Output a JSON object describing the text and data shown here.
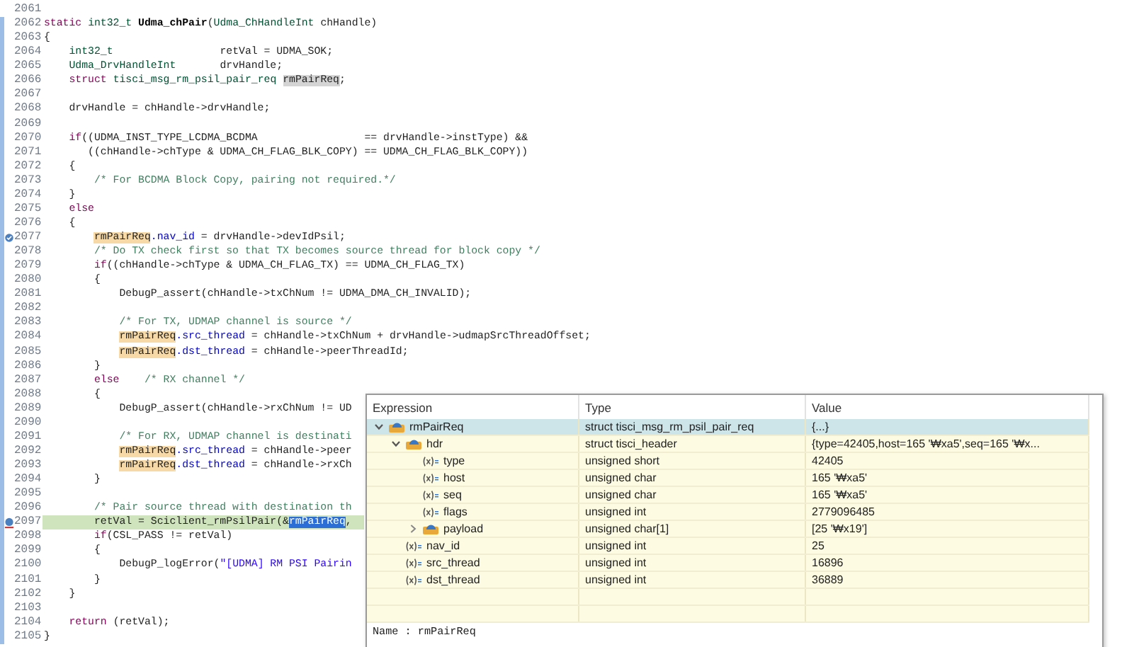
{
  "editor": {
    "lines": [
      {
        "n": "2061"
      },
      {
        "n": "2062",
        "segments": [
          {
            "kind": "keyword",
            "text": "static"
          },
          {
            "kind": "type",
            "text": " int32_t"
          },
          {
            "kind": "func",
            "text": " Udma_chPair"
          },
          {
            "kind": "plain",
            "text": "("
          },
          {
            "kind": "type",
            "text": "Udma_ChHandleInt"
          },
          {
            "kind": "plain",
            "text": " chHandle)"
          }
        ]
      },
      {
        "n": "2063",
        "segments": [
          {
            "kind": "plain",
            "text": "{"
          }
        ]
      },
      {
        "n": "2064",
        "segments": [
          {
            "kind": "type",
            "text": "    int32_t"
          },
          {
            "kind": "plain",
            "text": "                 retVal = UDMA_SOK;"
          }
        ]
      },
      {
        "n": "2065",
        "segments": [
          {
            "kind": "type",
            "text": "    Udma_DrvHandleInt"
          },
          {
            "kind": "plain",
            "text": "       drvHandle;"
          }
        ]
      },
      {
        "n": "2066",
        "segments": [
          {
            "kind": "keyword",
            "text": "    struct"
          },
          {
            "kind": "type",
            "text": " tisci_msg_rm_psil_pair_req"
          },
          {
            "kind": "declaration",
            "text": " rmPairReq"
          },
          {
            "kind": "plain",
            "text": ";"
          }
        ]
      },
      {
        "n": "2067"
      },
      {
        "n": "2068",
        "segments": [
          {
            "kind": "plain",
            "text": "    drvHandle = chHandle->drvHandle;"
          }
        ]
      },
      {
        "n": "2069"
      },
      {
        "n": "2070",
        "segments": [
          {
            "kind": "keyword",
            "text": "    if"
          },
          {
            "kind": "plain",
            "text": "((UDMA_INST_TYPE_LCDMA_BCDMA                 == drvHandle->instType) &&"
          }
        ]
      },
      {
        "n": "2071",
        "segments": [
          {
            "kind": "plain",
            "text": "       ((chHandle->chType & UDMA_CH_FLAG_BLK_COPY) == UDMA_CH_FLAG_BLK_COPY))"
          }
        ]
      },
      {
        "n": "2072",
        "segments": [
          {
            "kind": "plain",
            "text": "    {"
          }
        ]
      },
      {
        "n": "2073",
        "segments": [
          {
            "kind": "comment",
            "text": "        /* For BCDMA Block Copy, pairing not required.*/"
          }
        ]
      },
      {
        "n": "2074",
        "segments": [
          {
            "kind": "plain",
            "text": "    }"
          }
        ]
      },
      {
        "n": "2075",
        "segments": [
          {
            "kind": "keyword",
            "text": "    else"
          }
        ]
      },
      {
        "n": "2076",
        "segments": [
          {
            "kind": "plain",
            "text": "    {"
          }
        ]
      },
      {
        "n": "2077",
        "kind": "breakpoint",
        "segments": [
          {
            "kind": "occurrence",
            "text": "        rmPairReq"
          },
          {
            "kind": "field",
            "text": ".nav_id"
          },
          {
            "kind": "plain",
            "text": " = drvHandle->devIdPsil;"
          }
        ]
      },
      {
        "n": "2078",
        "segments": [
          {
            "kind": "comment",
            "text": "        /* Do TX check first so that TX becomes source thread for block copy */"
          }
        ]
      },
      {
        "n": "2079",
        "segments": [
          {
            "kind": "keyword",
            "text": "        if"
          },
          {
            "kind": "plain",
            "text": "((chHandle->chType & UDMA_CH_FLAG_TX) == UDMA_CH_FLAG_TX)"
          }
        ]
      },
      {
        "n": "2080",
        "segments": [
          {
            "kind": "plain",
            "text": "        {"
          }
        ]
      },
      {
        "n": "2081",
        "segments": [
          {
            "kind": "plain",
            "text": "            DebugP_assert(chHandle->txChNum != UDMA_DMA_CH_INVALID);"
          }
        ]
      },
      {
        "n": "2082"
      },
      {
        "n": "2083",
        "segments": [
          {
            "kind": "comment",
            "text": "            /* For TX, UDMAP channel is source */"
          }
        ]
      },
      {
        "n": "2084",
        "segments": [
          {
            "kind": "occurrence",
            "text": "            rmPairReq"
          },
          {
            "kind": "field",
            "text": ".src_thread"
          },
          {
            "kind": "plain",
            "text": " = chHandle->txChNum + drvHandle->udmapSrcThreadOffset;"
          }
        ]
      },
      {
        "n": "2085",
        "segments": [
          {
            "kind": "occurrence",
            "text": "            rmPairReq"
          },
          {
            "kind": "field",
            "text": ".dst_thread"
          },
          {
            "kind": "plain",
            "text": " = chHandle->peerThreadId;"
          }
        ]
      },
      {
        "n": "2086",
        "segments": [
          {
            "kind": "plain",
            "text": "        }"
          }
        ]
      },
      {
        "n": "2087",
        "segments": [
          {
            "kind": "keyword",
            "text": "        else"
          },
          {
            "kind": "comment",
            "text": "    /* RX channel */"
          }
        ]
      },
      {
        "n": "2088",
        "segments": [
          {
            "kind": "plain",
            "text": "        {"
          }
        ]
      },
      {
        "n": "2089",
        "segments": [
          {
            "kind": "plain",
            "text": "            DebugP_assert(chHandle->rxChNum != UD"
          }
        ]
      },
      {
        "n": "2090"
      },
      {
        "n": "2091",
        "segments": [
          {
            "kind": "comment",
            "text": "            /* For RX, UDMAP channel is destinati"
          }
        ]
      },
      {
        "n": "2092",
        "segments": [
          {
            "kind": "occurrence",
            "text": "            rmPairReq"
          },
          {
            "kind": "field",
            "text": ".src_thread"
          },
          {
            "kind": "plain",
            "text": " = chHandle->peer"
          }
        ]
      },
      {
        "n": "2093",
        "segments": [
          {
            "kind": "occurrence",
            "text": "            rmPairReq"
          },
          {
            "kind": "field",
            "text": ".dst_thread"
          },
          {
            "kind": "plain",
            "text": " = chHandle->rxCh"
          }
        ]
      },
      {
        "n": "2094",
        "segments": [
          {
            "kind": "plain",
            "text": "        }"
          }
        ]
      },
      {
        "n": "2095"
      },
      {
        "n": "2096",
        "segments": [
          {
            "kind": "comment",
            "text": "        /* Pair source thread with destination th"
          }
        ]
      },
      {
        "n": "2097",
        "kind": "current",
        "current": true,
        "segments": [
          {
            "kind": "plain",
            "text": "        retVal = Sciclient_rmPsilPair(&"
          },
          {
            "kind": "selection",
            "text": "rmPairReq"
          },
          {
            "kind": "plain",
            "text": ","
          }
        ]
      },
      {
        "n": "2098",
        "segments": [
          {
            "kind": "keyword",
            "text": "        if"
          },
          {
            "kind": "plain",
            "text": "(CSL_PASS != retVal)"
          }
        ]
      },
      {
        "n": "2099",
        "segments": [
          {
            "kind": "plain",
            "text": "        {"
          }
        ]
      },
      {
        "n": "2100",
        "segments": [
          {
            "kind": "plain",
            "text": "            DebugP_logError("
          },
          {
            "kind": "string",
            "text": "\"[UDMA] RM PSI Pairin"
          }
        ]
      },
      {
        "n": "2101",
        "segments": [
          {
            "kind": "plain",
            "text": "        }"
          }
        ]
      },
      {
        "n": "2102",
        "segments": [
          {
            "kind": "plain",
            "text": "    }"
          }
        ]
      },
      {
        "n": "2103"
      },
      {
        "n": "2104",
        "segments": [
          {
            "kind": "keyword",
            "text": "    return"
          },
          {
            "kind": "plain",
            "text": " (retVal);"
          }
        ]
      },
      {
        "n": "2105",
        "segments": [
          {
            "kind": "plain",
            "text": "}"
          }
        ]
      }
    ]
  },
  "hover": {
    "columns": [
      "Expression",
      "Type",
      "Value"
    ],
    "rows": [
      {
        "name": "rmPairReq",
        "kind": "struct",
        "type": "struct tisci_msg_rm_psil_pair_req",
        "value": "{...}",
        "selected": true,
        "expanded": true,
        "children": [
          {
            "name": "hdr",
            "kind": "struct",
            "type": "struct tisci_header",
            "value": "{type=42405,host=165 '₩xa5',seq=165 '₩x...",
            "selected": false,
            "expanded": true,
            "children": [
              {
                "name": "type",
                "kind": "variable",
                "type": "unsigned short",
                "value": "42405",
                "selected": false
              },
              {
                "name": "host",
                "kind": "variable",
                "type": "unsigned char",
                "value": "165 '₩xa5'",
                "selected": false
              },
              {
                "name": "seq",
                "kind": "variable",
                "type": "unsigned char",
                "value": "165 '₩xa5'",
                "selected": false
              },
              {
                "name": "flags",
                "kind": "variable",
                "type": "unsigned int",
                "value": "2779096485",
                "selected": false
              },
              {
                "name": "payload",
                "kind": "struct",
                "type": "unsigned char[1]",
                "value": "[25 '₩x19']",
                "selected": false,
                "expanded": false
              }
            ]
          },
          {
            "name": "nav_id",
            "kind": "variable",
            "type": "unsigned int",
            "value": "25",
            "selected": false
          },
          {
            "name": "src_thread",
            "kind": "variable",
            "type": "unsigned int",
            "value": "16896",
            "selected": false
          },
          {
            "name": "dst_thread",
            "kind": "variable",
            "type": "unsigned int",
            "value": "36889",
            "selected": false
          }
        ]
      }
    ],
    "detail": "Name : rmPairReq"
  }
}
